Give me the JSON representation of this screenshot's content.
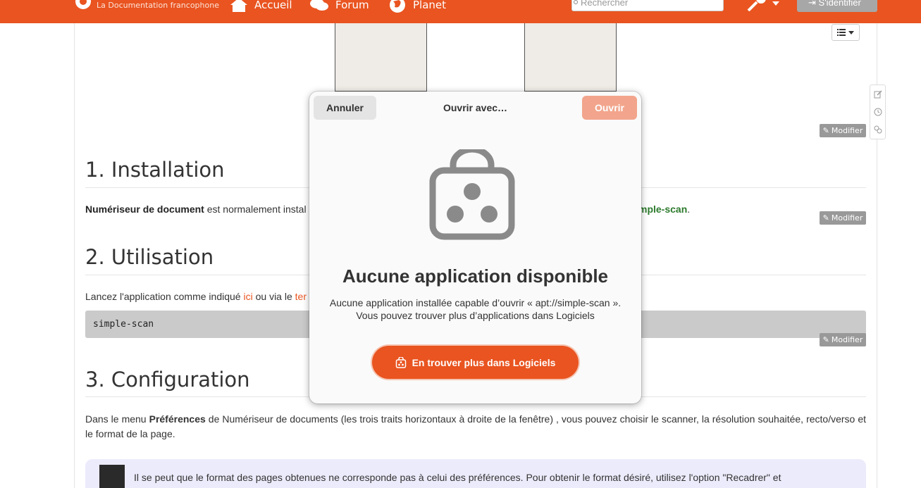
{
  "topbar": {
    "site_subtitle": "La Documentation francophone",
    "nav": [
      "Accueil",
      "Forum",
      "Planet"
    ],
    "search_placeholder": "Rechercher",
    "login_label": "S'identifier"
  },
  "page": {
    "modify_label": "Modifier",
    "sections": [
      {
        "title": "1. Installation"
      },
      {
        "title": "2. Utilisation"
      },
      {
        "title": "3. Configuration"
      }
    ],
    "install_text": {
      "bold": "Numériseur de document",
      "rest": " est normalement instal",
      "tail_link": "mple-scan",
      "tail_end": "."
    },
    "usage_text": {
      "pre": "Lancez l'application comme indiqué ",
      "link1": "ici",
      "mid": " ou via le ",
      "link2": "ter"
    },
    "code": "simple-scan",
    "config_text": {
      "pre": "Dans le menu ",
      "bold": "Préférences",
      "rest": " de Numériseur de documents (les trois traits horizontaux à droite de la fenêtre) , vous pouvez choisir le scanner, la résolution souhaitée, recto/verso et le format de la page."
    },
    "note_text": "Il se peut que le format des pages obtenues ne corresponde pas à celui des préférences. Pour obtenir le format désiré, utilisez l'option \"Recadrer\" et"
  },
  "dialog": {
    "cancel_label": "Annuler",
    "title": "Ouvrir avec…",
    "open_label": "Ouvrir",
    "heading": "Aucune application disponible",
    "desc_line1": "Aucune application installée capable d’ouvrir « apt://simple-scan ».",
    "desc_line2": "Vous pouvez trouver plus d’applications dans Logiciels",
    "store_button": "En trouver plus dans Logiciels"
  },
  "colors": {
    "accent": "#e95420",
    "open_disabled": "#f2a58c"
  }
}
